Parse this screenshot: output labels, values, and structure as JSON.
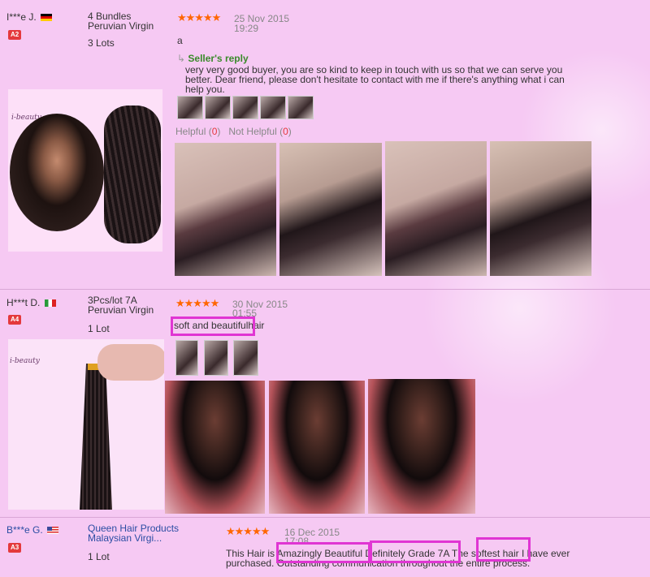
{
  "reviews": [
    {
      "buyer": "I***e J.",
      "country_flag": "germany-flag-icon",
      "level": "A2",
      "product": "4 Bundles Peruvian Virgin",
      "lots": "3 Lots",
      "rating": 5,
      "stars": "★★★★★",
      "date": "25 Nov 2015",
      "time": "19:29",
      "text": "a",
      "seller_reply_label": "Seller's reply",
      "seller_reply": "very very good buyer, you are so kind to keep in touch with us so that we can serve you better. Dear friend, please don't hesitate to contact with me if there's anything what i can help you.",
      "helpful_label": "Helpful (",
      "helpful_count": "0",
      "not_helpful_label": "Not Helpful (",
      "not_helpful_count": "0",
      "close_paren": ")",
      "brand_logo": "i-beauty"
    },
    {
      "buyer": "H***t D.",
      "country_flag": "italy-flag-icon",
      "level": "A4",
      "product": "3Pcs/lot 7A Peruvian Virgin",
      "lots": "1 Lot",
      "rating": 5,
      "stars": "★★★★★",
      "date": "30 Nov 2015",
      "time": "01:55",
      "text_highlight": "soft and beautiful",
      "text_rest": "hair",
      "brand_logo": "i-beauty"
    },
    {
      "buyer": "B***e G.",
      "country_flag": "usa-flag-icon",
      "level": "A3",
      "product": "Queen Hair Products Malaysian Virgi...",
      "lots": "1 Lot",
      "rating": 5,
      "stars": "★★★★★",
      "date": "16 Dec 2015",
      "time": "17:08",
      "text_line1": "This Hair is Amazingly Beautiful  Definitely Grade 7A  The softest hair I have ever",
      "text_line2": "purchased. Outstanding communication throughout the entire process."
    }
  ],
  "colors": {
    "background": "#f6c9f3",
    "highlight_box": "#e035d3",
    "star": "#ff6600",
    "reply_green": "#3a8a2a",
    "level_badge": "#e4393c"
  }
}
